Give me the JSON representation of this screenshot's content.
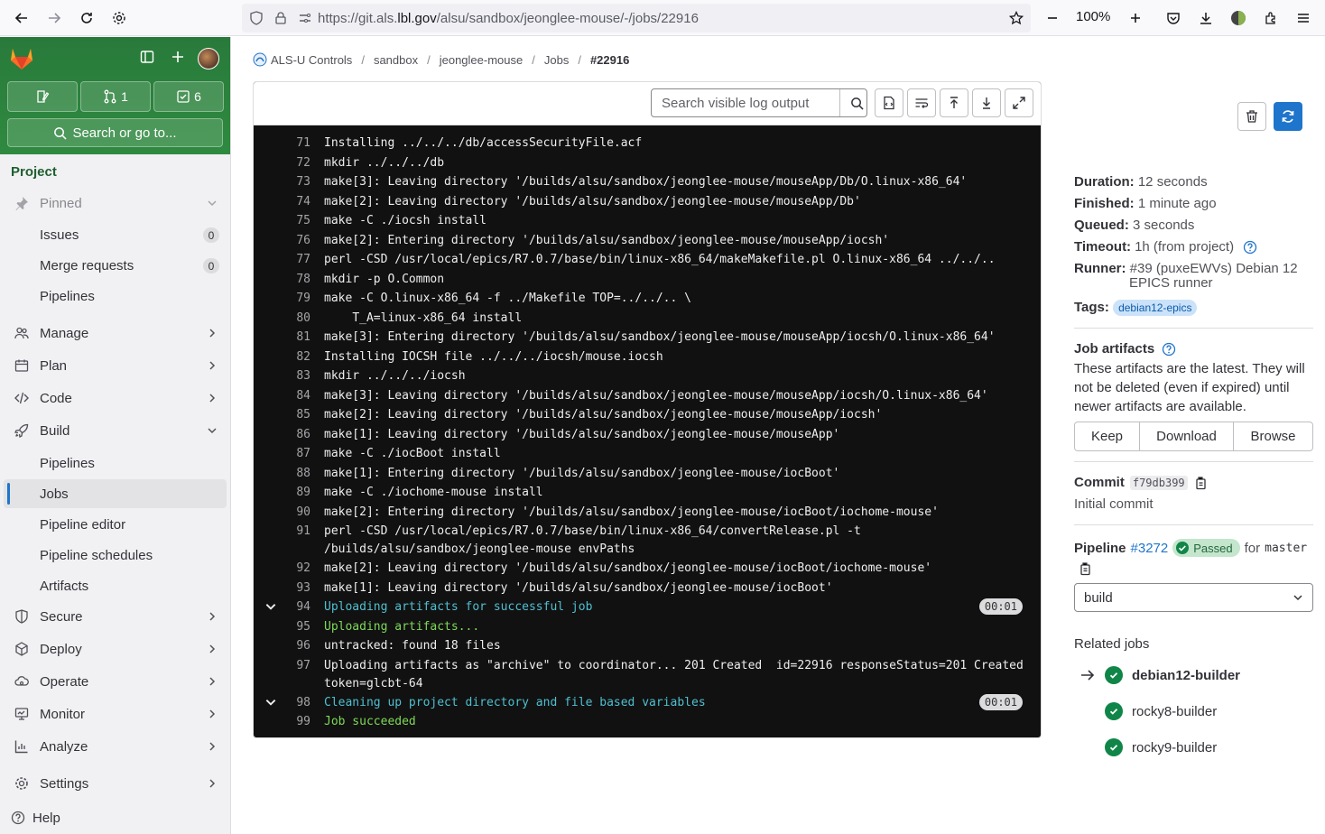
{
  "browser": {
    "url_prefix": "https://git.als.",
    "url_domain": "lbl.gov",
    "url_path": "/alsu/sandbox/jeonglee-mouse/-/jobs/22916",
    "zoom": "100%"
  },
  "sidebar": {
    "merge_count": "1",
    "todo_count": "6",
    "search_label": "Search or go to...",
    "section": "Project",
    "pinned": "Pinned",
    "pinned_items": [
      {
        "label": "Issues",
        "badge": "0"
      },
      {
        "label": "Merge requests",
        "badge": "0"
      },
      {
        "label": "Pipelines"
      }
    ],
    "groups": {
      "manage": "Manage",
      "plan": "Plan",
      "code": "Code",
      "build": "Build",
      "secure": "Secure",
      "deploy": "Deploy",
      "operate": "Operate",
      "monitor": "Monitor",
      "analyze": "Analyze",
      "settings": "Settings"
    },
    "build_items": [
      "Pipelines",
      "Jobs",
      "Pipeline editor",
      "Pipeline schedules",
      "Artifacts"
    ],
    "help": "Help"
  },
  "breadcrumb": {
    "items": [
      "ALS-U Controls",
      "sandbox",
      "jeonglee-mouse",
      "Jobs",
      "#22916"
    ]
  },
  "log": {
    "search_placeholder": "Search visible log output",
    "lines": [
      {
        "n": "71",
        "t": "Installing ../../../db/accessSecurityFile.acf"
      },
      {
        "n": "72",
        "t": "mkdir ../../../db"
      },
      {
        "n": "73",
        "t": "make[3]: Leaving directory '/builds/alsu/sandbox/jeonglee-mouse/mouseApp/Db/O.linux-x86_64'"
      },
      {
        "n": "74",
        "t": "make[2]: Leaving directory '/builds/alsu/sandbox/jeonglee-mouse/mouseApp/Db'"
      },
      {
        "n": "75",
        "t": "make -C ./iocsh install"
      },
      {
        "n": "76",
        "t": "make[2]: Entering directory '/builds/alsu/sandbox/jeonglee-mouse/mouseApp/iocsh'"
      },
      {
        "n": "77",
        "t": "perl -CSD /usr/local/epics/R7.0.7/base/bin/linux-x86_64/makeMakefile.pl O.linux-x86_64 ../../.."
      },
      {
        "n": "78",
        "t": "mkdir -p O.Common"
      },
      {
        "n": "79",
        "t": "make -C O.linux-x86_64 -f ../Makefile TOP=../../.. \\"
      },
      {
        "n": "80",
        "t": "    T_A=linux-x86_64 install"
      },
      {
        "n": "81",
        "t": "make[3]: Entering directory '/builds/alsu/sandbox/jeonglee-mouse/mouseApp/iocsh/O.linux-x86_64'"
      },
      {
        "n": "82",
        "t": "Installing IOCSH file ../../../iocsh/mouse.iocsh"
      },
      {
        "n": "83",
        "t": "mkdir ../../../iocsh"
      },
      {
        "n": "84",
        "t": "make[3]: Leaving directory '/builds/alsu/sandbox/jeonglee-mouse/mouseApp/iocsh/O.linux-x86_64'"
      },
      {
        "n": "85",
        "t": "make[2]: Leaving directory '/builds/alsu/sandbox/jeonglee-mouse/mouseApp/iocsh'"
      },
      {
        "n": "86",
        "t": "make[1]: Leaving directory '/builds/alsu/sandbox/jeonglee-mouse/mouseApp'"
      },
      {
        "n": "87",
        "t": "make -C ./iocBoot install"
      },
      {
        "n": "88",
        "t": "make[1]: Entering directory '/builds/alsu/sandbox/jeonglee-mouse/iocBoot'"
      },
      {
        "n": "89",
        "t": "make -C ./iochome-mouse install"
      },
      {
        "n": "90",
        "t": "make[2]: Entering directory '/builds/alsu/sandbox/jeonglee-mouse/iocBoot/iochome-mouse'"
      },
      {
        "n": "91",
        "t": "perl -CSD /usr/local/epics/R7.0.7/base/bin/linux-x86_64/convertRelease.pl -t /builds/alsu/sandbox/jeonglee-mouse envPaths"
      },
      {
        "n": "92",
        "t": "make[2]: Leaving directory '/builds/alsu/sandbox/jeonglee-mouse/iocBoot/iochome-mouse'"
      },
      {
        "n": "93",
        "t": "make[1]: Leaving directory '/builds/alsu/sandbox/jeonglee-mouse/iocBoot'"
      },
      {
        "n": "94",
        "t": "Uploading artifacts for successful job",
        "kind": "sec",
        "dur": "00:01"
      },
      {
        "n": "95",
        "t": "Uploading artifacts...",
        "kind": "ok"
      },
      {
        "n": "96",
        "t": "untracked: found 18 files"
      },
      {
        "n": "97",
        "t": "Uploading artifacts as \"archive\" to coordinator... 201 Created  id=22916 responseStatus=201 Created token=glcbt-64"
      },
      {
        "n": "98",
        "t": "Cleaning up project directory and file based variables",
        "kind": "sec",
        "dur": "00:01"
      },
      {
        "n": "99",
        "t": "Job succeeded",
        "kind": "ok"
      }
    ]
  },
  "details": {
    "duration_label": "Duration:",
    "duration": "12 seconds",
    "finished_label": "Finished:",
    "finished": "1 minute ago",
    "queued_label": "Queued:",
    "queued": "3 seconds",
    "timeout_label": "Timeout:",
    "timeout": "1h (from project)",
    "runner_label": "Runner:",
    "runner_line1": "#39 (puxeEWVs) Debian 12",
    "runner_line2": "EPICS runner",
    "tags_label": "Tags:",
    "tag": "debian12-epics"
  },
  "artifacts": {
    "title": "Job artifacts",
    "line1": "These artifacts are the latest. They will",
    "line2": "not be deleted (even if expired) until",
    "line3": "newer artifacts are available.",
    "keep": "Keep",
    "download": "Download",
    "browse": "Browse"
  },
  "commit": {
    "label": "Commit",
    "sha": "f79db399",
    "message": "Initial commit"
  },
  "pipeline": {
    "label": "Pipeline",
    "id": "#3272",
    "status": "Passed",
    "for": "for",
    "ref": "master",
    "stage": "build"
  },
  "related": {
    "title": "Related jobs",
    "jobs": [
      "debian12-builder",
      "rocky8-builder",
      "rocky9-builder"
    ]
  },
  "colors": {
    "brand": "#2f8a40",
    "accent": "#1f75cb",
    "success": "#108548"
  }
}
